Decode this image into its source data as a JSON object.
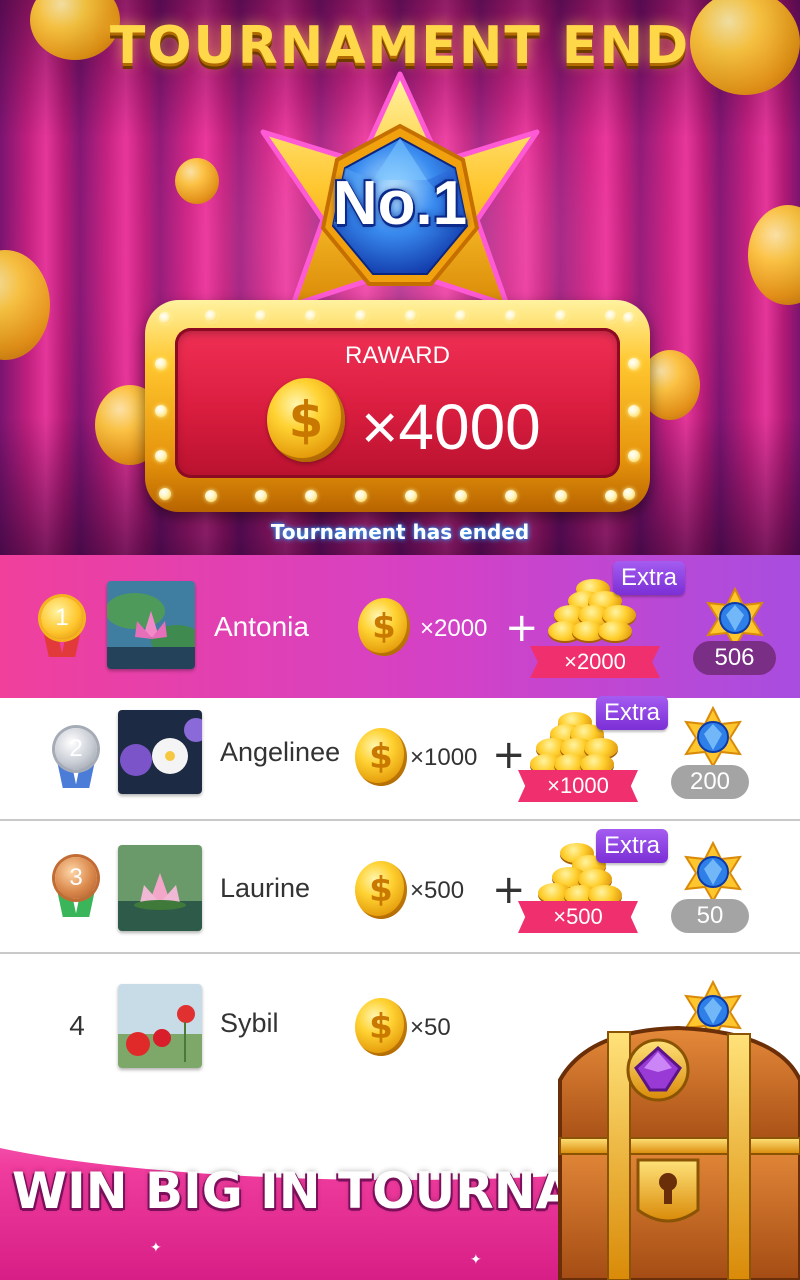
{
  "header": {
    "title": "TOURNAMENT END",
    "rank_badge": "No.1",
    "reward_label": "RAWARD",
    "reward_currency_icon": "gold-coin-icon",
    "reward_amount": "×4000",
    "status_text": "Tournament has ended"
  },
  "leaderboard": {
    "rows": [
      {
        "rank": "1",
        "name": "Antonia",
        "coins": "×2000",
        "extra_label": "Extra",
        "extra_coins": "×2000",
        "score": "506"
      },
      {
        "rank": "2",
        "name": "Angelinee",
        "coins": "×1000",
        "extra_label": "Extra",
        "extra_coins": "×1000",
        "score": "200"
      },
      {
        "rank": "3",
        "name": "Laurine",
        "coins": "×500",
        "extra_label": "Extra",
        "extra_coins": "×500",
        "score": "50"
      },
      {
        "rank": "4",
        "name": "Sybil",
        "coins": "×50"
      }
    ]
  },
  "promo": {
    "headline": "WIN BIG IN TOURNAMENT"
  },
  "colors": {
    "accent_pink": "#f0409c",
    "accent_purple": "#a84de0",
    "gold": "#ffd232",
    "extra_tag": "#7b2fd6",
    "bonus_ribbon": "#f0306e"
  },
  "icons": {
    "coin": "dollar-coin-icon",
    "coin_pile": "coin-pile-icon",
    "gem_star": "sapphire-star-icon",
    "medal_gold": "gold-medal-icon",
    "medal_silver": "silver-medal-icon",
    "medal_bronze": "bronze-medal-icon",
    "chest": "treasure-chest-icon"
  }
}
